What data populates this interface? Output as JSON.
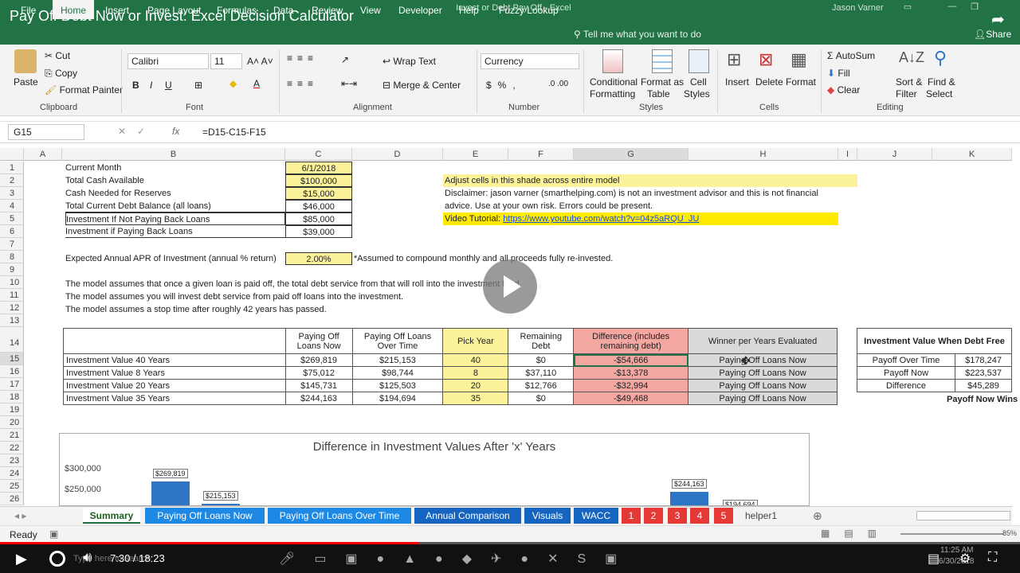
{
  "video": {
    "title": "Pay Off Debt Now or Invest: Excel Decision Calculator",
    "time": "7:30 / 18:23"
  },
  "window": {
    "title": "Invest or Debt Pay Off  -  Excel",
    "user": "Jason Varner",
    "share": "Share",
    "tellme": "Tell me what you want to do"
  },
  "menu": [
    "File",
    "Home",
    "Insert",
    "Page Layout",
    "Formulas",
    "Data",
    "Review",
    "View",
    "Developer",
    "Help",
    "Fuzzy Lookup"
  ],
  "ribbon": {
    "clipboard": {
      "paste": "Paste",
      "cut": "Cut",
      "copy": "Copy",
      "painter": "Format Painter",
      "label": "Clipboard"
    },
    "font": {
      "name": "Calibri",
      "size": "11",
      "label": "Font",
      "bold": "B",
      "italic": "I",
      "underline": "U"
    },
    "alignment": {
      "wrap": "Wrap Text",
      "merge": "Merge & Center",
      "label": "Alignment"
    },
    "number": {
      "format": "Currency",
      "label": "Number"
    },
    "styles": {
      "cond": "Conditional",
      "cond2": "Formatting",
      "fmt": "Format as",
      "fmt2": "Table",
      "cell": "Cell",
      "cell2": "Styles",
      "label": "Styles"
    },
    "cells": {
      "insert": "Insert",
      "delete": "Delete",
      "format": "Format",
      "label": "Cells"
    },
    "editing": {
      "autosum": "AutoSum",
      "fill": "Fill",
      "clear": "Clear",
      "sort": "Sort &",
      "sort2": "Filter",
      "find": "Find &",
      "find2": "Select",
      "label": "Editing"
    }
  },
  "formulabar": {
    "namebox": "G15",
    "formula": "=D15-C15-F15"
  },
  "columns": [
    "A",
    "B",
    "C",
    "D",
    "E",
    "F",
    "G",
    "H",
    "I",
    "J",
    "K"
  ],
  "rows": [
    "1",
    "2",
    "3",
    "4",
    "5",
    "6",
    "7",
    "8",
    "9",
    "10",
    "11",
    "12",
    "13",
    "14",
    "15",
    "16",
    "17",
    "18",
    "19",
    "20",
    "21",
    "22",
    "23",
    "24",
    "25",
    "26"
  ],
  "inputs": [
    {
      "label": "Current Month",
      "value": "6/1/2018"
    },
    {
      "label": "Total Cash Available",
      "value": "$100,000"
    },
    {
      "label": "Cash Needed for Reserves",
      "value": "$15,000"
    },
    {
      "label": "Total Current Debt Balance (all loans)",
      "value": "$46,000"
    },
    {
      "label": "Investment If Not Paying Back Loans",
      "value": "$85,000"
    },
    {
      "label": "Investment if Paying Back Loans",
      "value": "$39,000"
    }
  ],
  "apr": {
    "label": "Expected Annual APR of Investment (annual % return)",
    "value": "2.00%",
    "note": "*Assumed to compound monthly and all proceeds fully re-invested."
  },
  "notes": [
    "The model assumes that once a given loan is paid off, the total debt service from that will roll into the investment fund.",
    "The model assumes you will invest debt service from paid off loans into the investment.",
    "The model assumes a stop time after roughly 42 years has passed."
  ],
  "info": {
    "shade": "Adjust cells in this shade across entire model",
    "disclaimer1": "Disclaimer: jason varner (smarthelping.com) is not an investment advisor and this is not financial",
    "disclaimer2": "advice. Use at your own risk. Errors could be present.",
    "tutorial_label": "Video Tutorial:",
    "tutorial_link": "https://www.youtube.com/watch?v=04z5aRQU_JU"
  },
  "table": {
    "headers": [
      "Paying Off Loans Now",
      "Paying Off Loans Over Time",
      "Pick Year",
      "Remaining Debt",
      "Difference (includes remaining debt)",
      "Winner per Years Evaluated"
    ],
    "rows": [
      {
        "label": "Investment Value 40 Years",
        "now": "$269,819",
        "over": "$215,153",
        "year": "40",
        "debt": "$0",
        "diff": "-$54,666",
        "winner": "Paying Off Loans Now"
      },
      {
        "label": "Investment Value 8 Years",
        "now": "$75,012",
        "over": "$98,744",
        "year": "8",
        "debt": "$37,110",
        "diff": "-$13,378",
        "winner": "Paying Off Loans Now"
      },
      {
        "label": "Investment Value 20 Years",
        "now": "$145,731",
        "over": "$125,503",
        "year": "20",
        "debt": "$12,766",
        "diff": "-$32,994",
        "winner": "Paying Off Loans Now"
      },
      {
        "label": "Investment Value 35 Years",
        "now": "$244,163",
        "over": "$194,694",
        "year": "35",
        "debt": "$0",
        "diff": "-$49,468",
        "winner": "Paying Off Loans Now"
      }
    ]
  },
  "debtfree": {
    "title": "Investment Value When Debt Free",
    "rows": [
      {
        "label": "Payoff Over Time",
        "value": "$178,247"
      },
      {
        "label": "Payoff Now",
        "value": "$223,537"
      },
      {
        "label": "Difference",
        "value": "$45,289"
      }
    ],
    "result": "Payoff Now Wins"
  },
  "chart_data": {
    "type": "bar",
    "title": "Difference in Investment Values After 'x' Years",
    "yticks": [
      "$300,000",
      "$250,000"
    ],
    "bars": [
      {
        "value": 269819,
        "label": "$269,819"
      },
      {
        "value": 215153,
        "label": "$215,153"
      },
      {
        "value": 244163,
        "label": "$244,163"
      },
      {
        "value": 194694,
        "label": "$194,694"
      }
    ],
    "colors": {
      "now": "#2e75c6",
      "over": "#2e75c6"
    }
  },
  "sheets": [
    {
      "name": "Summary",
      "color": "#ffffff",
      "text": "#1b5e20"
    },
    {
      "name": "Paying Off Loans Now",
      "color": "#1e88e5",
      "text": "#ffffff"
    },
    {
      "name": "Paying Off Loans Over Time",
      "color": "#1e88e5",
      "text": "#ffffff"
    },
    {
      "name": "Annual Comparison",
      "color": "#1565c0",
      "text": "#ffffff"
    },
    {
      "name": "Visuals",
      "color": "#1565c0",
      "text": "#ffffff"
    },
    {
      "name": "WACC",
      "color": "#1565c0",
      "text": "#ffffff"
    },
    {
      "name": "1",
      "color": "#e53935",
      "text": "#ffffff"
    },
    {
      "name": "2",
      "color": "#e53935",
      "text": "#ffffff"
    },
    {
      "name": "3",
      "color": "#e53935",
      "text": "#ffffff"
    },
    {
      "name": "4",
      "color": "#e53935",
      "text": "#ffffff"
    },
    {
      "name": "5",
      "color": "#e53935",
      "text": "#ffffff"
    },
    {
      "name": "helper1",
      "color": "#f3f3f3",
      "text": "#444444"
    }
  ],
  "status": {
    "ready": "Ready",
    "zoom": "85%"
  },
  "taskbar": {
    "search": "Type here to search",
    "clock": "11:25 AM",
    "date": "6/30/2018"
  }
}
